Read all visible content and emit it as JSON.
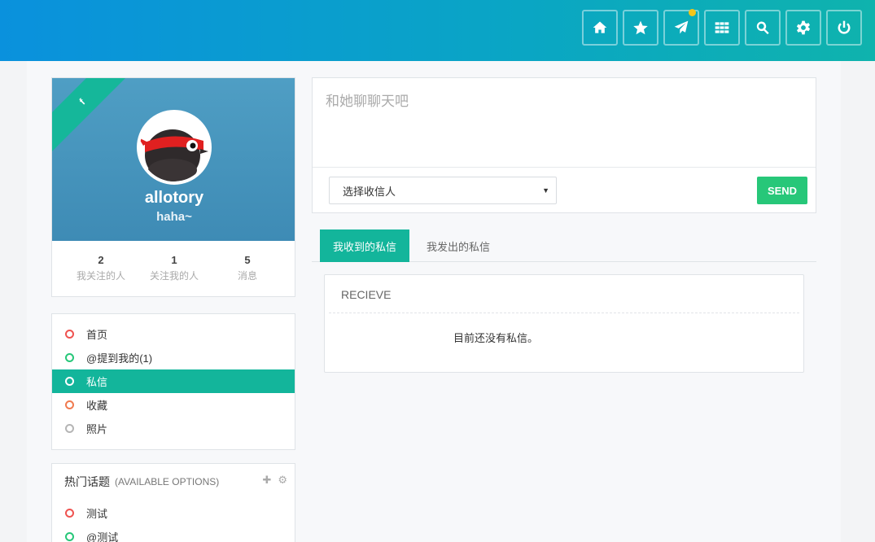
{
  "topbar": {
    "buttons": [
      {
        "icon": "home-icon"
      },
      {
        "icon": "star-icon"
      },
      {
        "icon": "paper-plane-icon",
        "has_notification": true
      },
      {
        "icon": "grid-icon"
      },
      {
        "icon": "search-icon"
      },
      {
        "icon": "gear-icon"
      },
      {
        "icon": "power-icon"
      }
    ],
    "notification_color": "#f5c518"
  },
  "profile": {
    "ribbon_label": "f",
    "username": "allotory",
    "signature": "haha~",
    "stats": [
      {
        "value": "2",
        "label": "我关注的人"
      },
      {
        "value": "1",
        "label": "关注我的人"
      },
      {
        "value": "5",
        "label": "消息"
      }
    ]
  },
  "nav": {
    "items": [
      {
        "label": "首页",
        "ring_color": "#ef5350"
      },
      {
        "label": "@提到我的(1)",
        "ring_color": "#27c779"
      },
      {
        "label": "私信",
        "ring_color": "#ffffff",
        "active": true
      },
      {
        "label": "收藏",
        "ring_color": "#f07a4f"
      },
      {
        "label": "照片",
        "ring_color": "#b5b5b5"
      }
    ]
  },
  "topics": {
    "title": "热门话题",
    "subtitle": "(AVAILABLE OPTIONS)",
    "items": [
      {
        "label": "测试",
        "ring_color": "#ef5350"
      },
      {
        "label": "@测试",
        "ring_color": "#27c779"
      }
    ]
  },
  "compose": {
    "placeholder": "和她聊聊天吧",
    "recipient_selected": "选择收信人",
    "send_label": "SEND"
  },
  "tabs": {
    "received": "我收到的私信",
    "sent": "我发出的私信"
  },
  "inbox": {
    "title": "RECIEVE",
    "empty_message": "目前还没有私信。"
  },
  "colors": {
    "accent": "#13b59b",
    "send": "#27c779",
    "topbar_start": "#0a91dd",
    "topbar_end": "#0fb3ad"
  }
}
